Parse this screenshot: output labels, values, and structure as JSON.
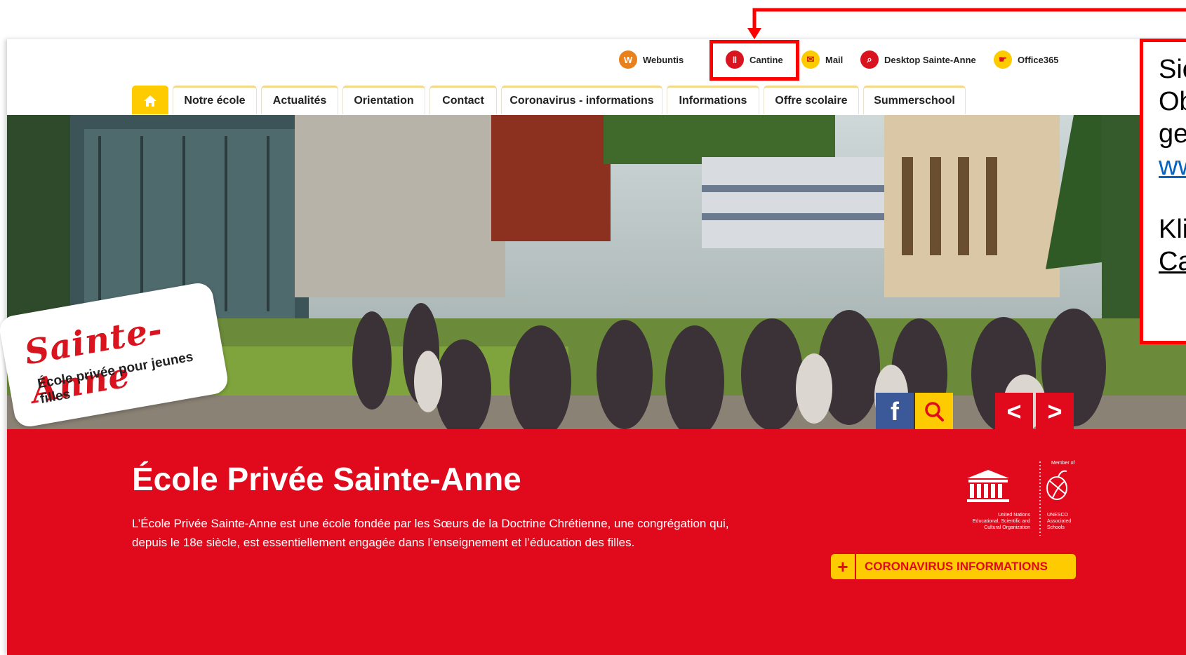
{
  "quicklinks": [
    {
      "label": "Webuntis",
      "icon": "webuntis-icon",
      "glyph": "W",
      "color": "#e8801c"
    },
    {
      "label": "Cantine",
      "icon": "fork-knife-icon",
      "glyph": "‖",
      "color": "#d9141e"
    },
    {
      "label": "Mail",
      "icon": "mail-icon",
      "glyph": "✉",
      "color": "#fecb00"
    },
    {
      "label": "Desktop Sainte-Anne",
      "icon": "desktop-icon",
      "glyph": "⌕",
      "color": "#d9141e"
    },
    {
      "label": "Office365",
      "icon": "office-icon",
      "glyph": "☛",
      "color": "#fecb00"
    }
  ],
  "nav": {
    "home_icon": "home-icon",
    "tabs": [
      "Notre école",
      "Actualités",
      "Orientation",
      "Contact",
      "Coronavirus - informations",
      "Informations",
      "Offre scolaire",
      "Summerschool"
    ]
  },
  "hero": {
    "logo_script": "Sainte-Anne",
    "logo_sub": "École privée pour jeunes filles",
    "buttons": [
      {
        "name": "facebook-button",
        "glyph": "f",
        "color": "#3b5998"
      },
      {
        "name": "search-button",
        "glyph": "⌕",
        "color": "#fecb00"
      },
      {
        "name": "prev-button",
        "glyph": "<",
        "color": "#e10a1c"
      },
      {
        "name": "next-button",
        "glyph": ">",
        "color": "#e10a1c"
      }
    ]
  },
  "band": {
    "title": "École Privée Sainte-Anne",
    "description": "L’École Privée Sainte-Anne est une école fondée par les Sœurs de la Doctrine Chrétienne, une congrégation qui, depuis le 18e siècle, est essentiellement engagée dans l’enseignement et l’éducation des filles.",
    "unesco": {
      "member_of": "Member of",
      "left_caption": [
        "United Nations",
        "Educational, Scientific and",
        "Cultural Organization"
      ],
      "right_caption": [
        "UNESCO",
        "Associated",
        "Schools"
      ]
    },
    "corona_button": "CORONAVIRUS INFORMATIONS"
  },
  "annotation": {
    "lines": [
      "Sie",
      "Ob",
      "ge",
      "ww",
      "Kli",
      "Ca"
    ]
  },
  "colors": {
    "red": "#e10a1c",
    "yellow": "#fecb00",
    "annotation": "#ff0000"
  }
}
